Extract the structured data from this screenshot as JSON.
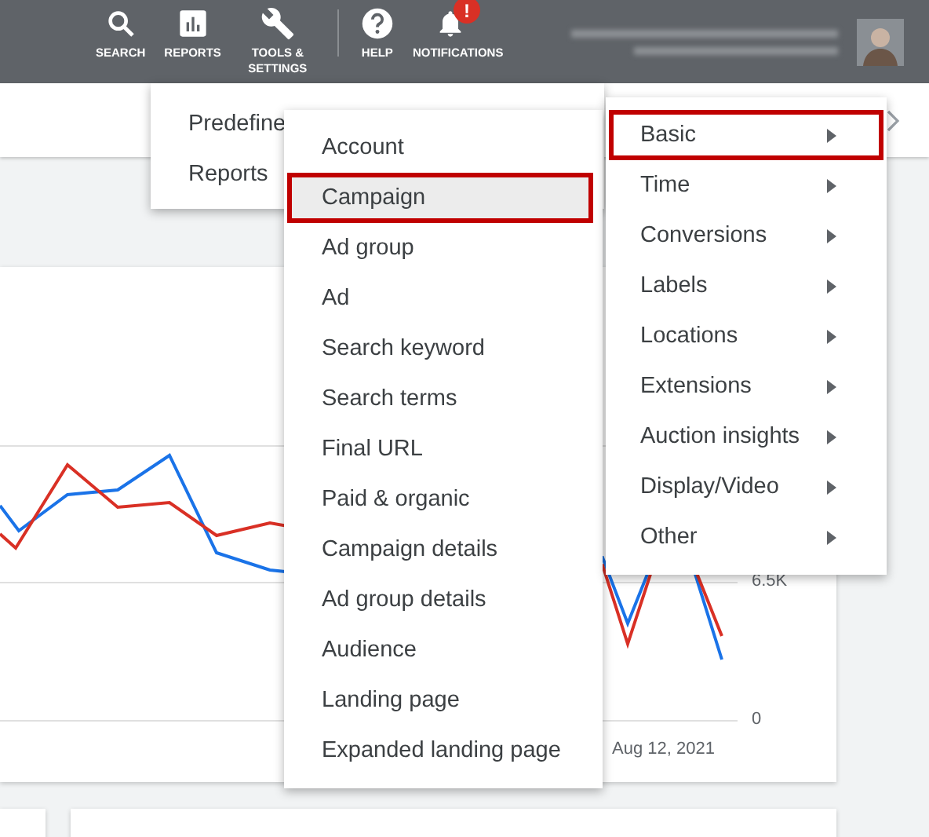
{
  "top_bar": {
    "nav": [
      {
        "kind": "search",
        "label": "SEARCH"
      },
      {
        "kind": "reports",
        "label": "REPORTS"
      },
      {
        "kind": "tools",
        "label": "TOOLS & SETTINGS"
      },
      {
        "kind": "help",
        "label": "HELP"
      },
      {
        "kind": "notifications",
        "label": "NOTIFICATIONS",
        "badge": "!"
      }
    ]
  },
  "chart": {
    "y_tick_labels": [
      "6.5K",
      "0"
    ],
    "x_axis_label": "Aug 12, 2021"
  },
  "reports_menu": {
    "items": [
      {
        "label": "Predefine"
      },
      {
        "label": "Reports"
      }
    ]
  },
  "predefined_menu": {
    "items": [
      {
        "label": "Account",
        "selected": false,
        "outlined": false
      },
      {
        "label": "Campaign",
        "selected": true,
        "outlined": true
      },
      {
        "label": "Ad group",
        "selected": false,
        "outlined": false
      },
      {
        "label": "Ad",
        "selected": false,
        "outlined": false
      },
      {
        "label": "Search keyword",
        "selected": false,
        "outlined": false
      },
      {
        "label": "Search terms",
        "selected": false,
        "outlined": false
      },
      {
        "label": "Final URL",
        "selected": false,
        "outlined": false
      },
      {
        "label": "Paid & organic",
        "selected": false,
        "outlined": false
      },
      {
        "label": "Campaign details",
        "selected": false,
        "outlined": false
      },
      {
        "label": "Ad group details",
        "selected": false,
        "outlined": false
      },
      {
        "label": "Audience",
        "selected": false,
        "outlined": false
      },
      {
        "label": "Landing page",
        "selected": false,
        "outlined": false
      },
      {
        "label": "Expanded landing page",
        "selected": false,
        "outlined": false
      }
    ]
  },
  "category_menu": {
    "items": [
      {
        "label": "Basic",
        "outlined": true
      },
      {
        "label": "Time",
        "outlined": false
      },
      {
        "label": "Conversions",
        "outlined": false
      },
      {
        "label": "Labels",
        "outlined": false
      },
      {
        "label": "Locations",
        "outlined": false
      },
      {
        "label": "Extensions",
        "outlined": false
      },
      {
        "label": "Auction insights",
        "outlined": false
      },
      {
        "label": "Display/Video",
        "outlined": false
      },
      {
        "label": "Other",
        "outlined": false
      }
    ]
  }
}
